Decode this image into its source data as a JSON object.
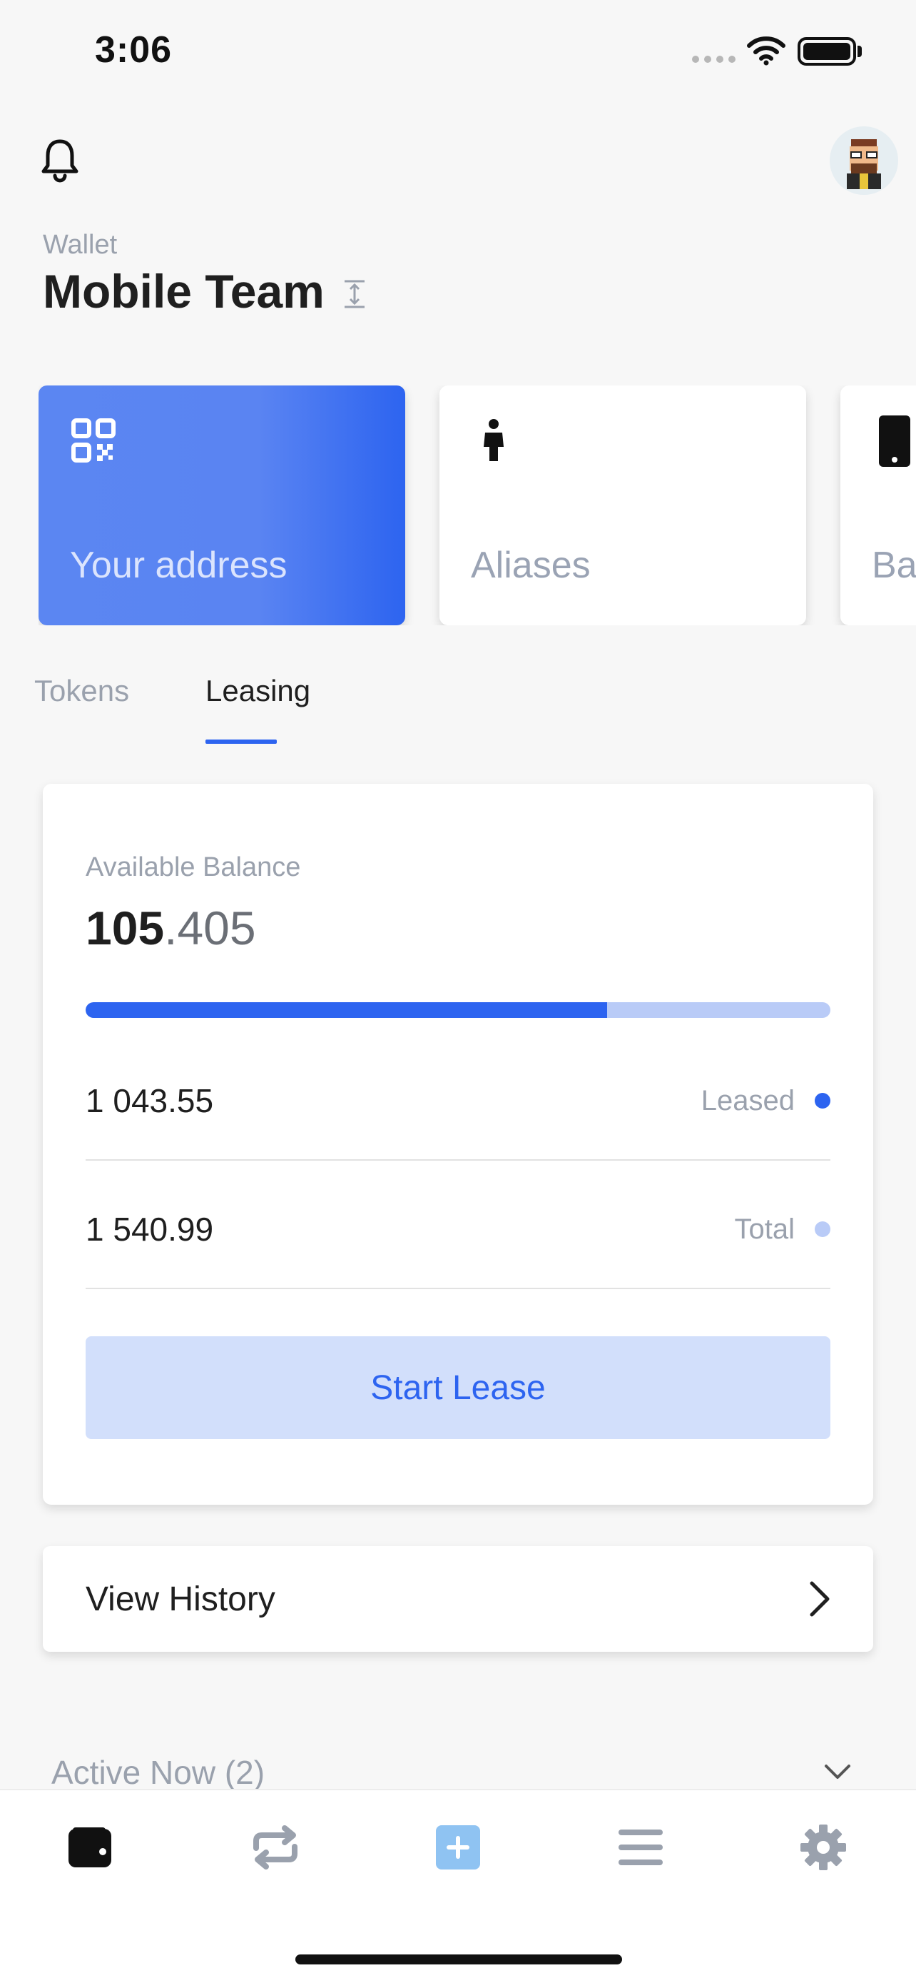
{
  "status_bar": {
    "time": "3:06"
  },
  "header": {
    "wallet_label": "Wallet",
    "wallet_name": "Mobile Team"
  },
  "cards": [
    {
      "label": "Your address",
      "icon": "qr-code-icon"
    },
    {
      "label": "Aliases",
      "icon": "person-icon"
    },
    {
      "label": "Ba",
      "icon": "phone-icon"
    }
  ],
  "tabs": [
    {
      "label": "Tokens",
      "active": false
    },
    {
      "label": "Leasing",
      "active": true
    }
  ],
  "leasing": {
    "available_label": "Available Balance",
    "available_int": "105",
    "available_dec": ".405",
    "leased_fraction": 0.7,
    "leased_value": "1 043.55",
    "leased_label": "Leased",
    "total_value": "1 540.99",
    "total_label": "Total",
    "start_lease_label": "Start Lease"
  },
  "history": {
    "label": "View History"
  },
  "active_now": {
    "label": "Active Now (2)"
  },
  "colors": {
    "accent": "#2d64f0",
    "accent_light": "#b9cbf7",
    "button_bg": "#d2dffb"
  },
  "bottom_nav": [
    {
      "icon": "wallet-icon",
      "active": true
    },
    {
      "icon": "exchange-icon",
      "active": false
    },
    {
      "icon": "add-icon",
      "active": false
    },
    {
      "icon": "menu-icon",
      "active": false
    },
    {
      "icon": "settings-icon",
      "active": false
    }
  ]
}
